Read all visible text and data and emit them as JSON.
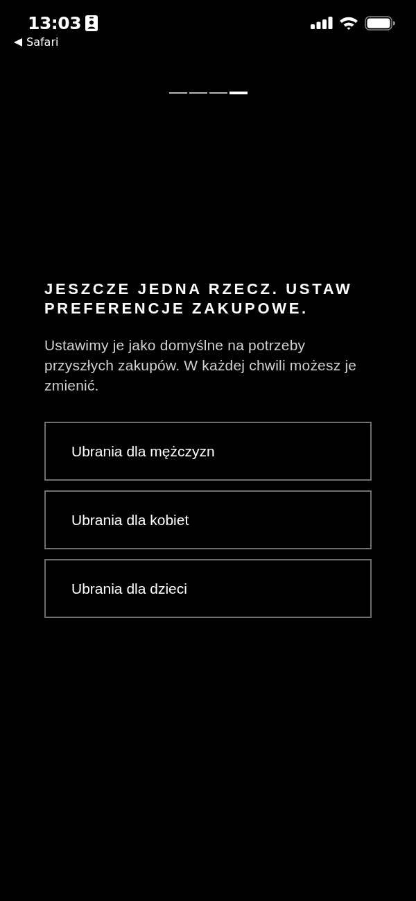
{
  "status_bar": {
    "time": "13:03",
    "back_label": "Safari"
  },
  "progress_steps": [
    {
      "selected": false
    },
    {
      "selected": false
    },
    {
      "selected": false
    },
    {
      "selected": true
    }
  ],
  "heading": "JESZCZE JEDNA RZECZ. USTAW PREFERENCJE ZAKUPOWE.",
  "description": "Ustawimy je jako domyślne na potrzeby przyszłych zakupów. W każdej chwili możesz je zmienić.",
  "options": [
    {
      "label": "Ubrania dla mężczyzn",
      "selected": false
    },
    {
      "label": "Ubrania dla kobiet",
      "selected": false
    },
    {
      "label": "Ubrania dla dzieci",
      "selected": false
    }
  ]
}
